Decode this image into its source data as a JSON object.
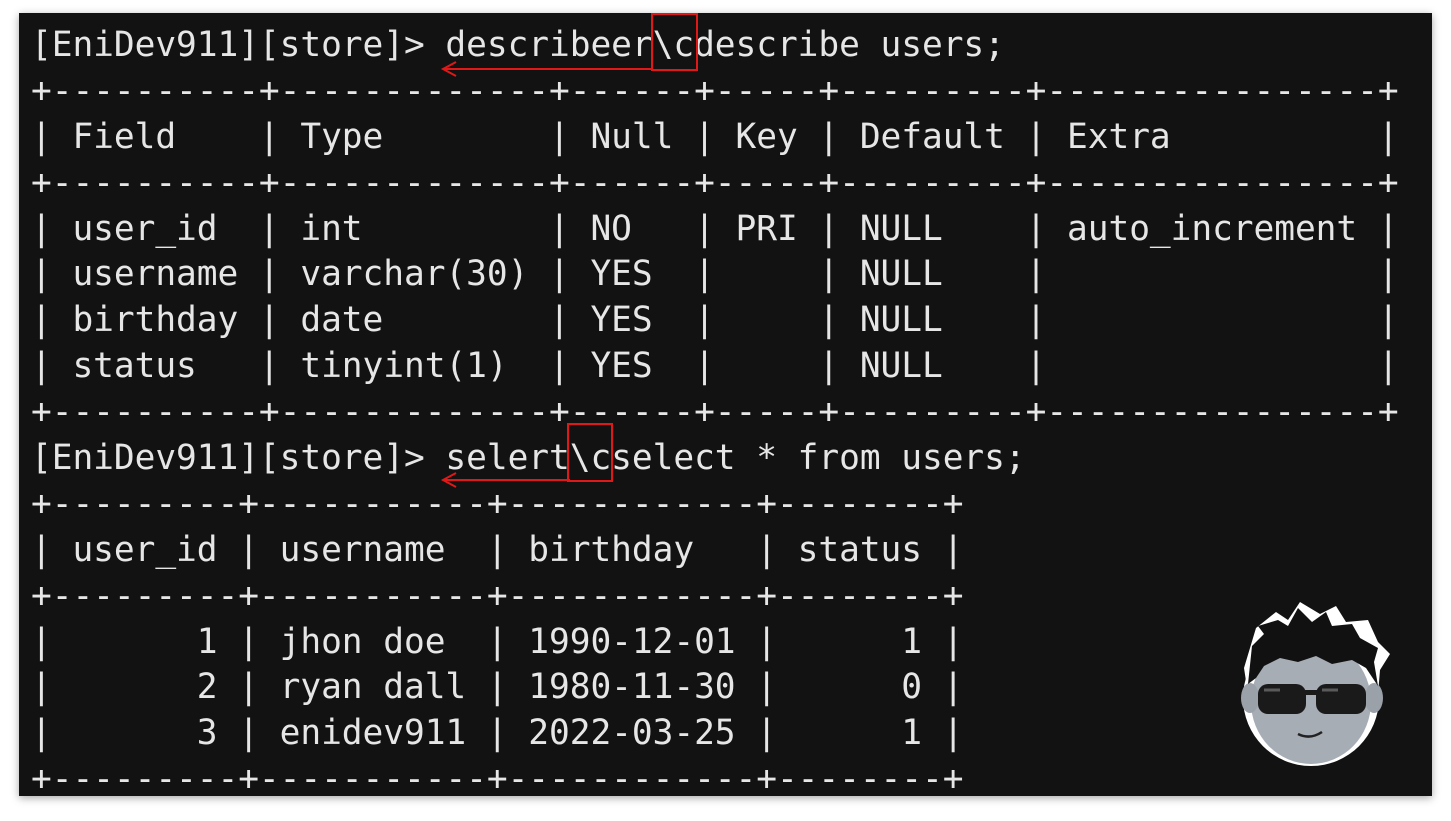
{
  "terminal": {
    "lines": [
      "[EniDev911][store]> describeer\\cdescribe users;",
      "+----------+-------------+------+-----+---------+----------------+",
      "| Field    | Type        | Null | Key | Default | Extra          |",
      "+----------+-------------+------+-----+---------+----------------+",
      "| user_id  | int         | NO   | PRI | NULL    | auto_increment |",
      "| username | varchar(30) | YES  |     | NULL    |                |",
      "| birthday | date        | YES  |     | NULL    |                |",
      "| status   | tinyint(1)  | YES  |     | NULL    |                |",
      "+----------+-------------+------+-----+---------+----------------+",
      "[EniDev911][store]> selert\\cselect * from users;",
      "+---------+-----------+------------+--------+",
      "| user_id | username  | birthday   | status |",
      "+---------+-----------+------------+--------+",
      "|       1 | jhon doe  | 1990-12-01 |      1 |",
      "|       2 | ryan dall | 1980-11-30 |      0 |",
      "|       3 | enidev911 | 2022-03-25 |      1 |",
      "+---------+-----------+------------+--------+"
    ]
  },
  "colors": {
    "background": "#121212",
    "text": "#e6e6e6",
    "highlight": "#e01818"
  },
  "icons": {
    "mascot": "cartoon-avatar-with-sunglasses-icon",
    "annotation_arrow": "left-arrow-icon"
  }
}
